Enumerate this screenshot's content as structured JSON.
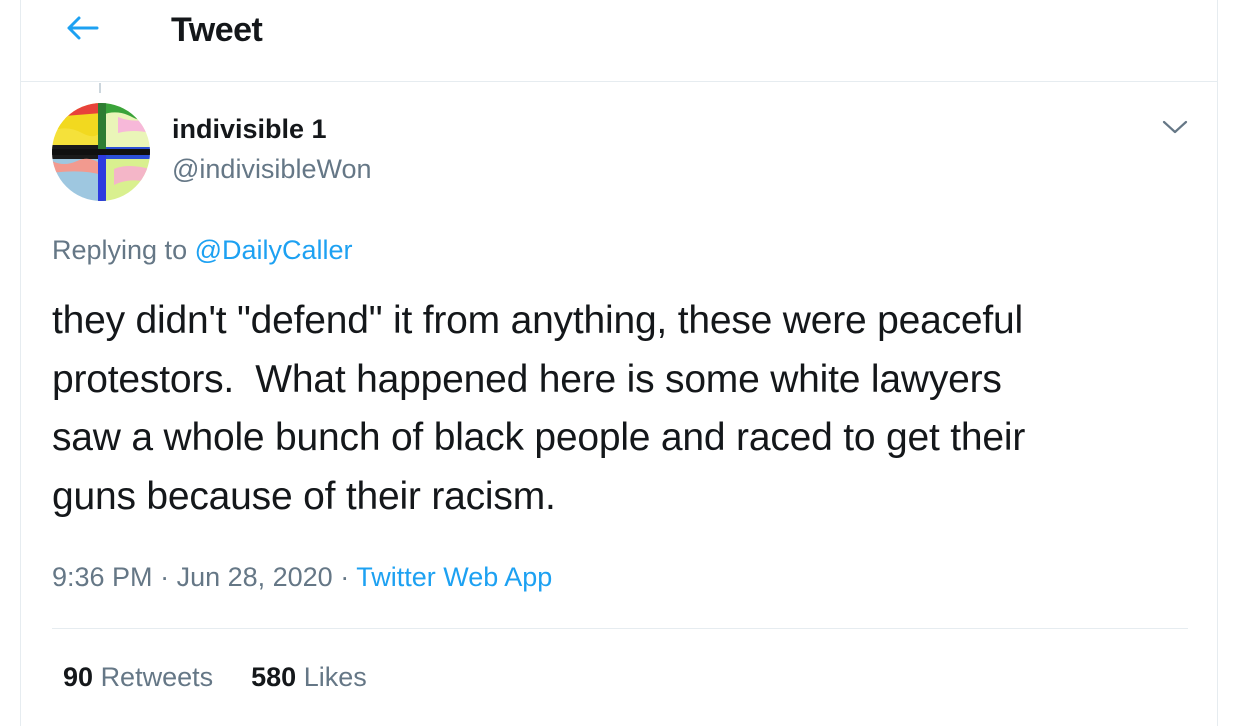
{
  "header": {
    "title": "Tweet",
    "back_icon": "arrow-left-icon"
  },
  "author": {
    "name": "indivisible 1",
    "handle": "@indivisibleWon",
    "avatar_icon": "colorful-quadrant-avatar"
  },
  "reply": {
    "prefix": "Replying to",
    "mention": "@DailyCaller"
  },
  "tweet": {
    "text": "they didn't \"defend\" it from anything, these were peaceful\nprotestors.  What happened here is some white lawyers\nsaw a whole bunch of black people and raced to get their\nguns because of their racism."
  },
  "meta": {
    "time": "9:36 PM",
    "separator1": " · ",
    "date": "Jun 28, 2020",
    "separator2": " · ",
    "source": "Twitter Web App"
  },
  "stats": {
    "retweets_count": "90",
    "retweets_label": "Retweets",
    "likes_count": "580",
    "likes_label": "Likes"
  },
  "colors": {
    "accent": "#1da1f2",
    "text_primary": "#14171a",
    "text_secondary": "#657786",
    "border": "#e6ecf0"
  }
}
